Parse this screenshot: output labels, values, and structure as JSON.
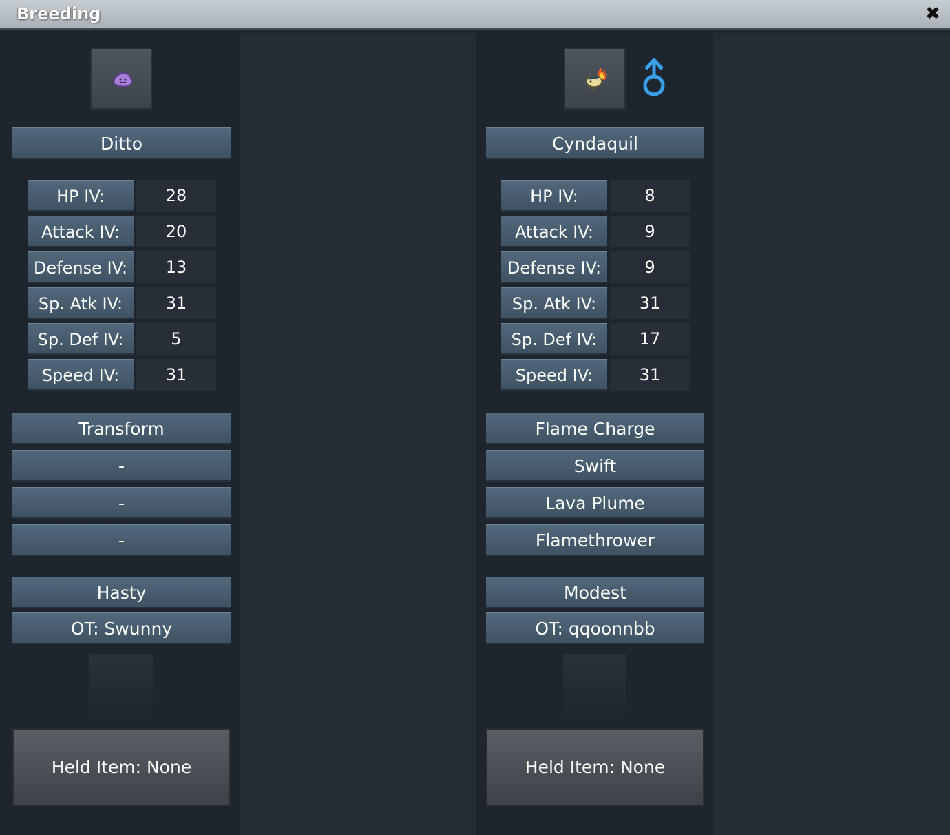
{
  "window": {
    "title": "Breeding",
    "close_icon": "close-icon"
  },
  "colors": {
    "bar": "#4a5f71",
    "male": "#3aa0e8"
  },
  "left": {
    "sprite": "ditto-sprite",
    "name": "Ditto",
    "stats": [
      {
        "label": "HP IV:",
        "value": "28"
      },
      {
        "label": "Attack IV:",
        "value": "20"
      },
      {
        "label": "Defense IV:",
        "value": "13"
      },
      {
        "label": "Sp. Atk IV:",
        "value": "31"
      },
      {
        "label": "Sp. Def IV:",
        "value": "5"
      },
      {
        "label": "Speed IV:",
        "value": "31"
      }
    ],
    "moves": [
      "Transform",
      "-",
      "-",
      "-"
    ],
    "nature": "Hasty",
    "ot": "OT: Swunny",
    "held_item": "Held Item: None"
  },
  "right": {
    "sprite": "cyndaquil-sprite",
    "gender_icon": "male-icon",
    "name": "Cyndaquil",
    "stats": [
      {
        "label": "HP IV:",
        "value": "8"
      },
      {
        "label": "Attack IV:",
        "value": "9"
      },
      {
        "label": "Defense IV:",
        "value": "9"
      },
      {
        "label": "Sp. Atk IV:",
        "value": "31"
      },
      {
        "label": "Sp. Def IV:",
        "value": "17"
      },
      {
        "label": "Speed IV:",
        "value": "31"
      }
    ],
    "moves": [
      "Flame Charge",
      "Swift",
      "Lava Plume",
      "Flamethrower"
    ],
    "nature": "Modest",
    "ot": "OT: qqoonnbb",
    "held_item": "Held Item: None"
  }
}
